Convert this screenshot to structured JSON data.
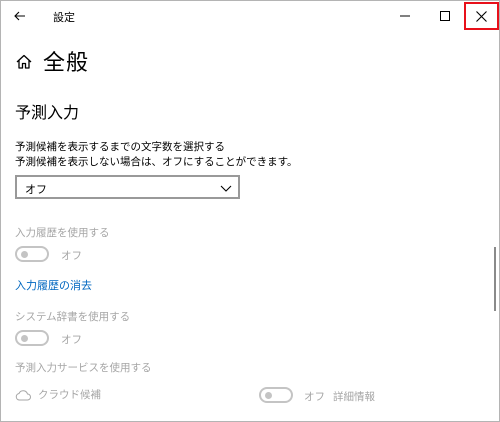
{
  "window": {
    "title": "設定"
  },
  "header": {
    "page_title": "全般",
    "section_title": "予測入力"
  },
  "predictive": {
    "description_line1": "予測候補を表示するまでの文字数を選択する",
    "description_line2": "予測候補を表示しない場合は、オフにすることができます。",
    "dropdown_value": "オフ"
  },
  "history": {
    "label": "入力履歴を使用する",
    "toggle_state": "オフ",
    "clear_link": "入力履歴の消去"
  },
  "system_dictionary": {
    "label": "システム辞書を使用する",
    "toggle_state": "オフ"
  },
  "service": {
    "label": "予測入力サービスを使用する",
    "cloud_label": "クラウド候補",
    "toggle_state": "オフ",
    "details_label": "詳細情報"
  },
  "colors": {
    "accent_link": "#0067c0",
    "highlight_close": "#e8101a",
    "disabled_text": "#a6a6a6"
  },
  "icons": {
    "back": "back-arrow-icon",
    "minimize": "minimize-icon",
    "maximize": "maximize-icon",
    "close": "close-icon",
    "home": "home-icon",
    "chevron": "chevron-down-icon",
    "cloud": "cloud-icon"
  }
}
